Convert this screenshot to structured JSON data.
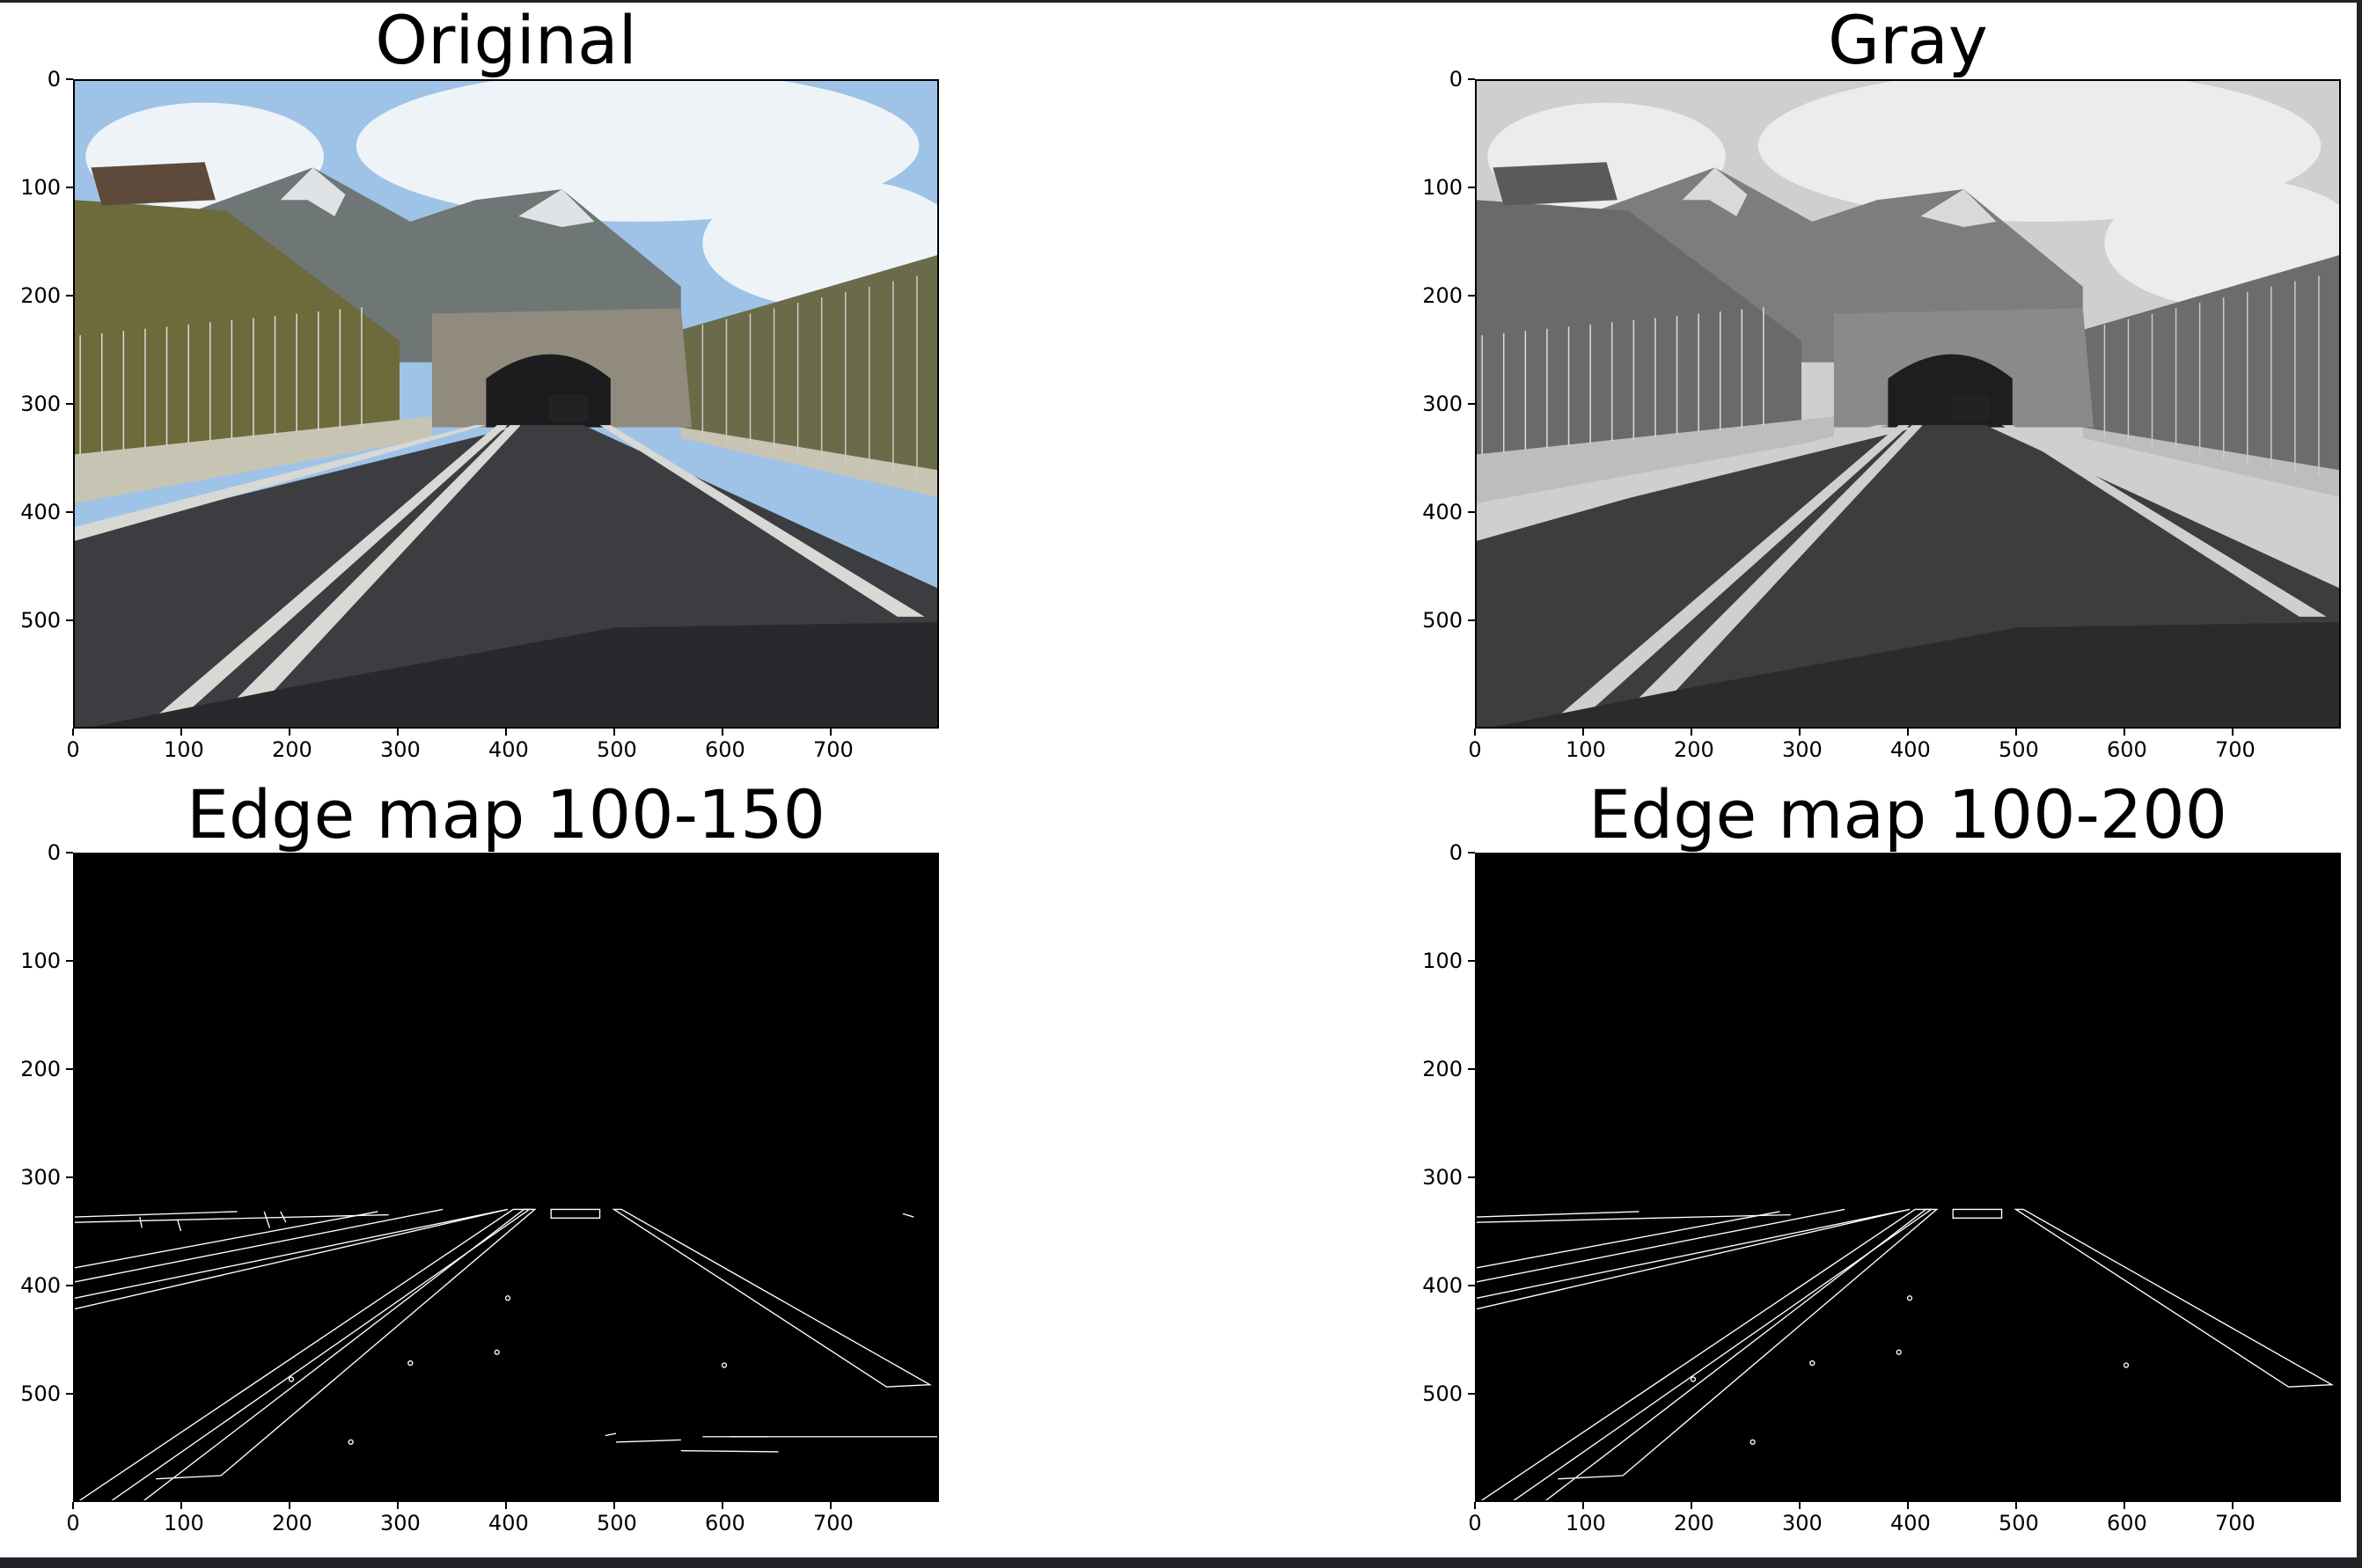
{
  "panels": [
    {
      "id": "original",
      "title": "Original",
      "kind": "photo-color"
    },
    {
      "id": "gray",
      "title": "Gray",
      "kind": "photo-gray"
    },
    {
      "id": "edge150",
      "title": "Edge map 100-150",
      "kind": "edge-150"
    },
    {
      "id": "edge200",
      "title": "Edge map 100-200",
      "kind": "edge-200"
    }
  ],
  "axes": {
    "x_ticks": [
      "0",
      "100",
      "200",
      "300",
      "400",
      "500",
      "600",
      "700"
    ],
    "y_ticks": [
      "0",
      "100",
      "200",
      "300",
      "400",
      "500"
    ],
    "x_range": [
      0,
      800
    ],
    "y_range": [
      0,
      600
    ],
    "y_inverted": true
  },
  "colors": {
    "sky": "#9ec3e6",
    "road": "#3c3c3c",
    "edge_line": "#ffffff",
    "edge_background": "#000000"
  }
}
